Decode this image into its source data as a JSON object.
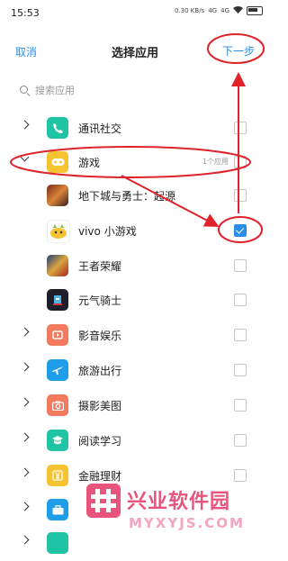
{
  "status_bar": {
    "time": "15:53",
    "net_speed": "0.30 KB/s",
    "signal_1": "4G",
    "signal_2": "4G"
  },
  "header": {
    "cancel_label": "取消",
    "title": "选择应用",
    "next_label": "下一步"
  },
  "search": {
    "placeholder": "搜索应用"
  },
  "categories": {
    "comm": {
      "label": "通讯社交",
      "icon": "phone-icon",
      "color": "#1ec4a4"
    },
    "games": {
      "label": "游戏",
      "icon": "gamepad-icon",
      "color": "#f6c431",
      "count": "1个应用"
    },
    "media": {
      "label": "影音娱乐",
      "icon": "play-icon",
      "color": "#f27b5f"
    },
    "travel": {
      "label": "旅游出行",
      "icon": "airplane-icon",
      "color": "#1e9de8"
    },
    "photo": {
      "label": "摄影美图",
      "icon": "camera-icon",
      "color": "#f27b5f"
    },
    "reading": {
      "label": "阅读学习",
      "icon": "graduation-cap-icon",
      "color": "#1ec4a4"
    },
    "finance": {
      "label": "金融理财",
      "icon": "yen-icon",
      "color": "#f6c431"
    },
    "work": {
      "label": "",
      "icon": "briefcase-icon",
      "color": "#1e9de8"
    },
    "shop": {
      "label": "",
      "icon": "cart-icon",
      "color": "#1ec4a4"
    }
  },
  "apps": {
    "dnf": {
      "label": "地下城与勇士：起源",
      "checked": false
    },
    "vivo_games": {
      "label": "vivo 小游戏",
      "checked": true
    },
    "honor_kings": {
      "label": "王者荣耀",
      "checked": false
    },
    "soul_knight": {
      "label": "元气骑士",
      "checked": false
    }
  },
  "annotation_color": "#e0222a",
  "accent_color": "#2a8ee8",
  "watermark": {
    "text": "兴业软件园",
    "domain": "MYXYJS.COM"
  }
}
